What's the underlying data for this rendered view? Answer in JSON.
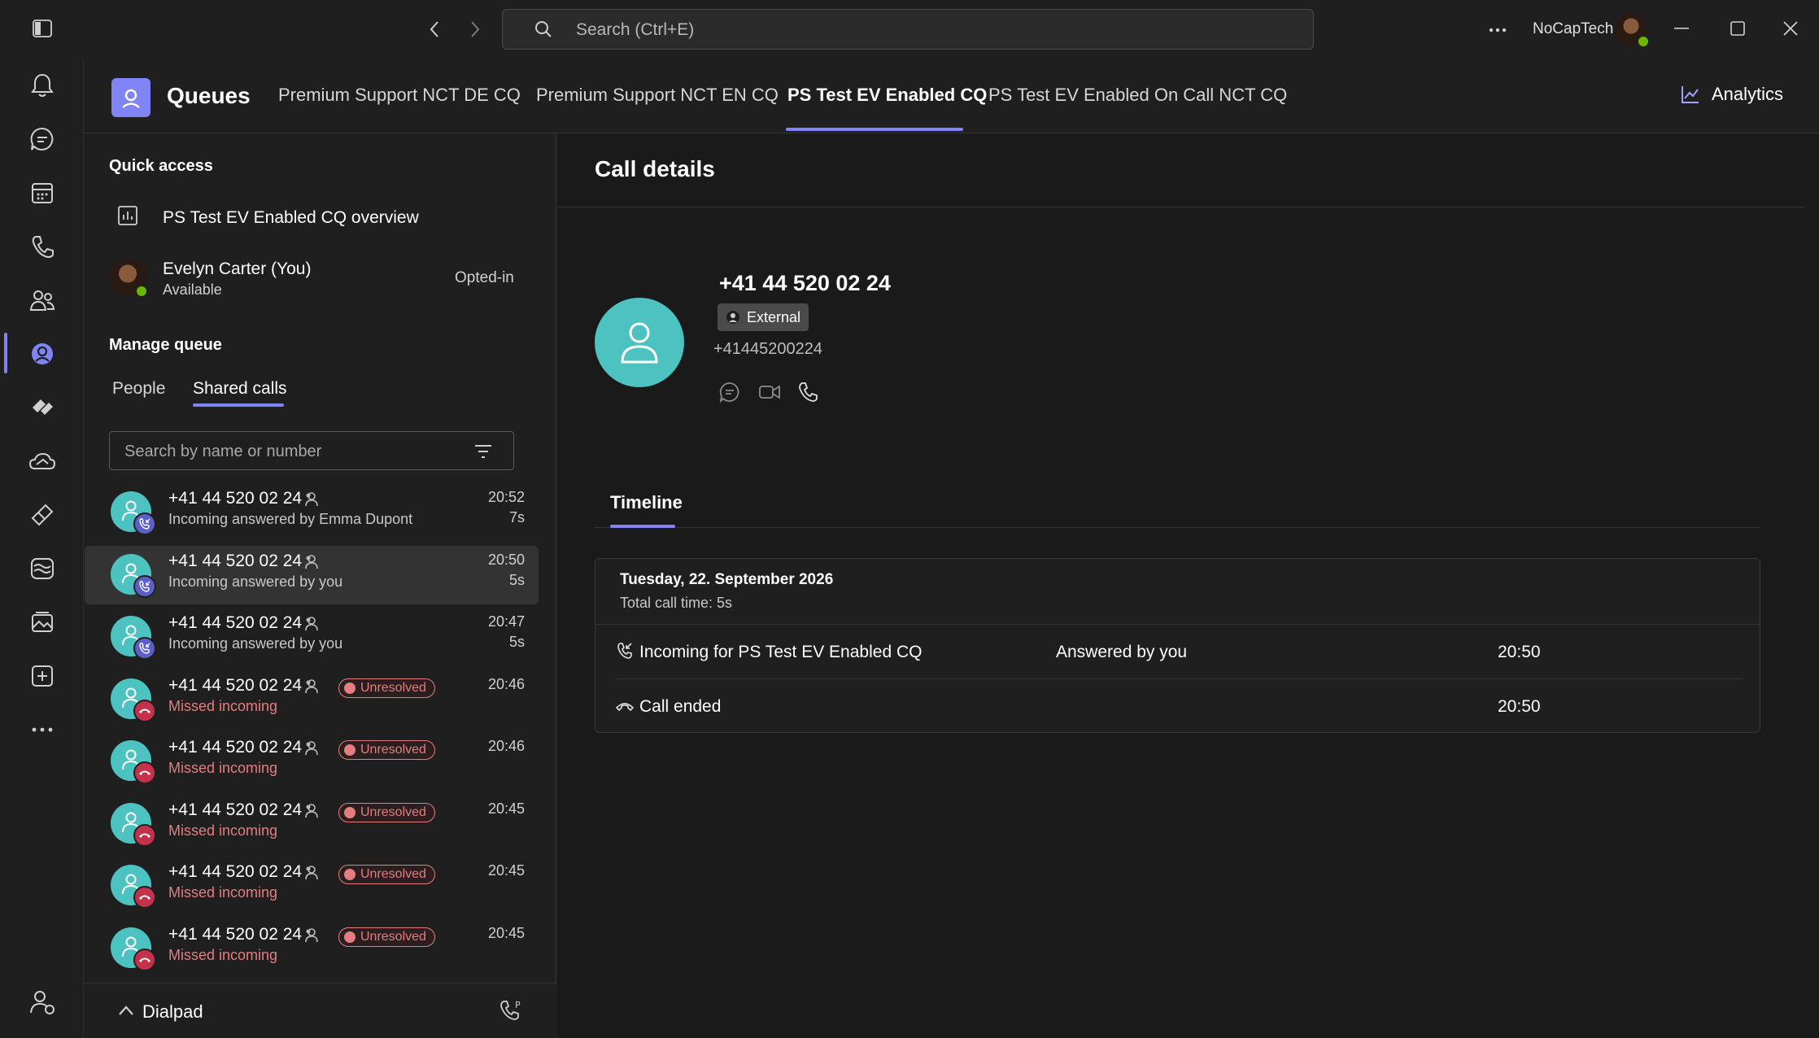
{
  "titlebar": {
    "search_placeholder": "Search (Ctrl+E)",
    "org_name": "NoCapTech"
  },
  "rail": {
    "items": [
      "bell-icon",
      "chat-icon",
      "calendar-icon",
      "calls-icon",
      "people-icon",
      "queues-icon",
      "viva-icon",
      "onedrive-icon",
      "planner-icon",
      "stream-icon",
      "photos-icon",
      "add-app-icon",
      "more-icon",
      "help-icon"
    ]
  },
  "header": {
    "app_title": "Queues",
    "tabs": [
      {
        "label": "Premium Support NCT DE CQ",
        "active": false
      },
      {
        "label": "Premium Support NCT EN CQ",
        "active": false
      },
      {
        "label": "PS Test EV Enabled CQ",
        "active": true
      },
      {
        "label": "PS Test EV Enabled On Call NCT CQ",
        "active": false
      }
    ],
    "analytics_label": "Analytics"
  },
  "left": {
    "quick_access_title": "Quick access",
    "overview_label": "PS Test EV Enabled CQ overview",
    "user_name": "Evelyn Carter (You)",
    "user_status": "Available",
    "opt_status": "Opted-in",
    "manage_title": "Manage queue",
    "subtabs": [
      "People",
      "Shared calls"
    ],
    "search_placeholder": "Search by name or number",
    "calls": [
      {
        "number": "+41 44 520 02 24",
        "sub": "Incoming answered by Emma Dupont",
        "time": "20:52",
        "dur": "7s",
        "missed": false,
        "selected": false
      },
      {
        "number": "+41 44 520 02 24",
        "sub": "Incoming answered by you",
        "time": "20:50",
        "dur": "5s",
        "missed": false,
        "selected": true
      },
      {
        "number": "+41 44 520 02 24",
        "sub": "Incoming answered by you",
        "time": "20:47",
        "dur": "5s",
        "missed": false,
        "selected": false
      },
      {
        "number": "+41 44 520 02 24",
        "sub": "Missed incoming",
        "time": "20:46",
        "dur": "",
        "missed": true,
        "badge": "Unresolved"
      },
      {
        "number": "+41 44 520 02 24",
        "sub": "Missed incoming",
        "time": "20:46",
        "dur": "",
        "missed": true,
        "badge": "Unresolved"
      },
      {
        "number": "+41 44 520 02 24",
        "sub": "Missed incoming",
        "time": "20:45",
        "dur": "",
        "missed": true,
        "badge": "Unresolved"
      },
      {
        "number": "+41 44 520 02 24",
        "sub": "Missed incoming",
        "time": "20:45",
        "dur": "",
        "missed": true,
        "badge": "Unresolved"
      },
      {
        "number": "+41 44 520 02 24",
        "sub": "Missed incoming",
        "time": "20:45",
        "dur": "",
        "missed": true,
        "badge": "Unresolved"
      }
    ],
    "dialpad_label": "Dialpad"
  },
  "detail": {
    "title": "Call details",
    "caller_number": "+41 44 520 02 24",
    "external_label": "External",
    "caller_raw": "+41445200224",
    "timeline_tab": "Timeline",
    "date": "Tuesday, 22. September 2026",
    "total": "Total call time: 5s",
    "events": [
      {
        "label": "Incoming for PS Test EV Enabled CQ",
        "status": "Answered by you",
        "time": "20:50"
      },
      {
        "label": "Call ended",
        "status": "",
        "time": "20:50"
      }
    ]
  },
  "colors": {
    "accent": "#7f85f5",
    "avatar": "#4dc3c1",
    "missed": "#e37d80"
  }
}
